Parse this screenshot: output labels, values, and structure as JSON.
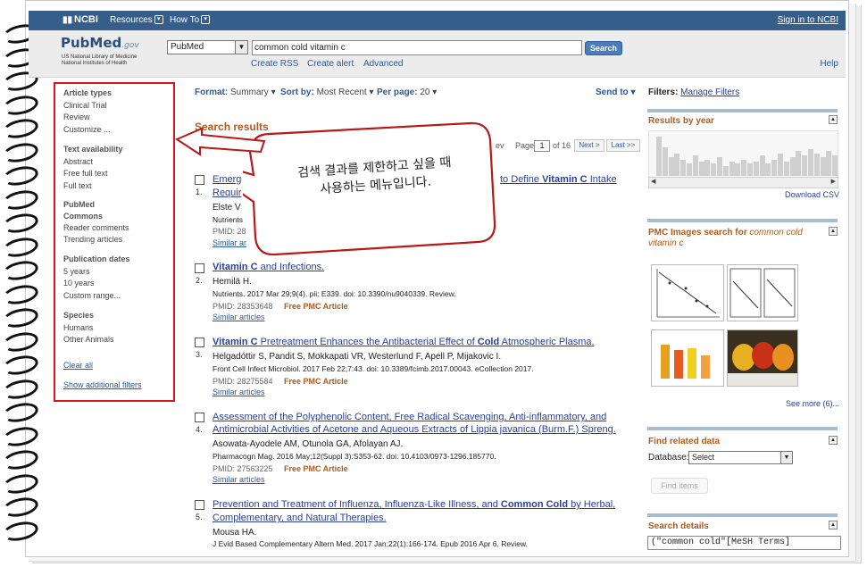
{
  "ncbi": {
    "logo": "NCBI",
    "resources": "Resources",
    "howto": "How To",
    "signin": "Sign in to NCBI"
  },
  "header": {
    "pubmed": "PubMed",
    "gov": ".gov",
    "nlm1": "US National Library of Medicine",
    "nlm2": "National Institutes of Health",
    "db_value": "PubMed",
    "query": "common cold vitamin c",
    "search_btn": "Search",
    "create_rss": "Create RSS",
    "create_alert": "Create alert",
    "advanced": "Advanced",
    "help": "Help"
  },
  "sidebar": {
    "article_types": "Article types",
    "clinical_trial": "Clinical Trial",
    "review": "Review",
    "customize": "Customize ...",
    "text_avail": "Text availability",
    "abstract": "Abstract",
    "free_full": "Free full text",
    "full_text": "Full text",
    "pubmed_commons_1": "PubMed",
    "pubmed_commons_2": "Commons",
    "reader_comments": "Reader comments",
    "trending": "Trending articles",
    "pub_dates": "Publication dates",
    "y5": "5 years",
    "y10": "10 years",
    "custom_range": "Custom range...",
    "species": "Species",
    "humans": "Humans",
    "other_animals": "Other Animals",
    "clear_all": "Clear all",
    "show_more": "Show additional filters"
  },
  "toolbar": {
    "format_label": "Format:",
    "format_value": "Summary",
    "sort_label": "Sort by:",
    "sort_value": "Most Recent",
    "perpage_label": "Per page:",
    "perpage_value": "20",
    "send_to": "Send to"
  },
  "results": {
    "title": "Search results",
    "pager_prev": "ev",
    "pager_page": "Page",
    "pager_value": "1",
    "pager_of": "of 16",
    "next": "Next >",
    "last": "Last >>",
    "items": [
      {
        "num": "1.",
        "t1": "Emerg",
        "t1b": "to Define",
        "t1c": "Vitamin C",
        "t1d": "Intake",
        "t2": "Requir",
        "author": "Elste V",
        "cite": "Nutrients",
        "pmid": "PMID: 28",
        "similar": "Similar ar"
      },
      {
        "num": "2.",
        "tb": "Vitamin C",
        "t": " and Infections.",
        "author": "Hemilä H.",
        "cite": "Nutrients. 2017 Mar 29;9(4). pii: E339. doi: 10.3390/nu9040339. Review.",
        "pmid": "PMID: 28353648",
        "free": "Free PMC Article",
        "similar": "Similar articles"
      },
      {
        "num": "3.",
        "tb": "Vitamin C",
        "t": " Pretreatment Enhances the Antibacterial Effect of ",
        "tb2": "Cold",
        "t2": " Atmospheric Plasma.",
        "author": "Helgadóttir S, Pandit S, Mokkapati VR, Westerlund F, Apell P, Mijakovic I.",
        "cite": "Front Cell Infect Microbiol. 2017 Feb 22;7:43. doi: 10.3389/fcimb.2017.00043. eCollection 2017.",
        "pmid": "PMID: 28275584",
        "free": "Free PMC Article",
        "similar": "Similar articles"
      },
      {
        "num": "4.",
        "t": "Assessment of the Polyphenolic Content, Free Radical Scavenging, Anti-inflammatory, and",
        "t2": "Antimicrobial Activities of Acetone and Aqueous Extracts of Lippia javanica (Burm.F.) Spreng.",
        "author": "Asowata-Ayodele AM, Otunola GA, Afolayan AJ.",
        "cite": "Pharmacogn Mag. 2016 May;12(Suppl 3):S353-62. doi: 10.4103/0973-1296.185770.",
        "pmid": "PMID: 27563225",
        "free": "Free PMC Article",
        "similar": "Similar articles"
      },
      {
        "num": "5.",
        "t": "Prevention and Treatment of Influenza, Influenza-Like Illness, and ",
        "tb": "Common Cold",
        "t_b": " by Herbal,",
        "t2": "Complementary, and Natural Therapies.",
        "author": "Mousa HA.",
        "cite": "J Evid Based Complementary Altern Med. 2017 Jan;22(1):166-174. Epub 2016 Apr 6. Review."
      }
    ]
  },
  "callout": {
    "line1": "검색 결과를 제한하고 싶을 때",
    "line2": "사용하는 메뉴입니다."
  },
  "right": {
    "filters_label": "Filters:",
    "manage": "Manage Filters",
    "results_by_year": "Results by year",
    "download_csv": "Download CSV",
    "pmc_images": "PMC Images search for ",
    "pmc_query": "common cold vitamin c",
    "see_more": "See more (6)...",
    "find_related": "Find related data",
    "database_label": "Database:",
    "database_value": "Select",
    "find_items": "Find items",
    "search_details": "Search details",
    "details_value": "(\"common cold\"[MeSH Terms]"
  },
  "year_bars": [
    0.95,
    0.7,
    0.45,
    0.55,
    0.4,
    0.3,
    0.5,
    0.35,
    0.4,
    0.3,
    0.45,
    0.25,
    0.35,
    0.3,
    0.4,
    0.3,
    0.35,
    0.5,
    0.3,
    0.4,
    0.55,
    0.35,
    0.45,
    0.6,
    0.5,
    0.65,
    0.55,
    0.45,
    0.6,
    0.5
  ]
}
